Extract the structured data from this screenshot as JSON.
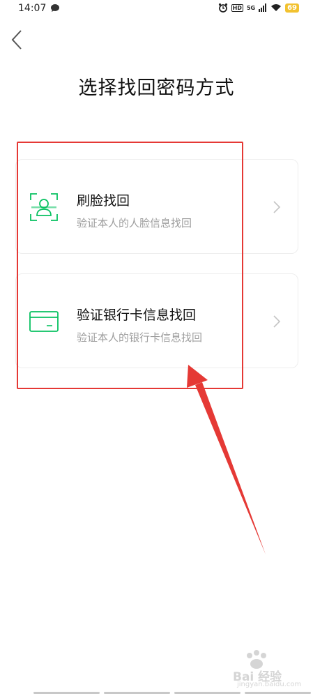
{
  "status_bar": {
    "time": "14:07",
    "hd": "HD",
    "network": "5G",
    "battery": "69"
  },
  "header": {
    "title": "选择找回密码方式"
  },
  "options": [
    {
      "title": "刷脸找回",
      "subtitle": "验证本人的人脸信息找回",
      "icon": "face-scan-icon"
    },
    {
      "title": "验证银行卡信息找回",
      "subtitle": "验证本人的银行卡信息找回",
      "icon": "bank-card-icon"
    }
  ],
  "watermark": {
    "text": "Bai 经验",
    "url": "jingyan.baidu.com"
  },
  "colors": {
    "accent_green": "#07c160",
    "annotation_red": "#e53935",
    "subtitle_gray": "#9e9e9e"
  }
}
